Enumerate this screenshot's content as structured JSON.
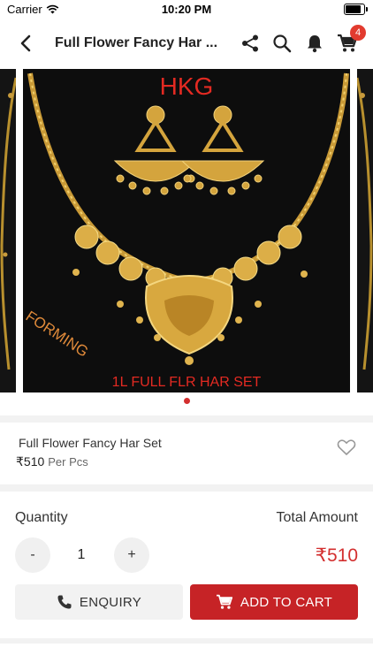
{
  "status": {
    "carrier": "Carrier",
    "time": "10:20 PM"
  },
  "nav": {
    "title": "Full Flower Fancy  Har ...",
    "cart_count": "4"
  },
  "gallery": {
    "brand_text": "HKG",
    "stamp_text": "FORMING",
    "caption": "1L FULL FLR HAR SET",
    "active_index": 0,
    "total_images": 1
  },
  "product": {
    "name": "Full Flower Fancy  Har Set",
    "price": "₹510",
    "unit": "Per Pcs"
  },
  "order": {
    "quantity_label": "Quantity",
    "total_label": "Total Amount",
    "minus": "-",
    "quantity": "1",
    "plus": "+",
    "total": "₹510"
  },
  "actions": {
    "enquiry": "ENQUIRY",
    "add_to_cart": "ADD TO CART"
  },
  "colors": {
    "accent": "#c62326",
    "price_red": "#d32f2f",
    "badge": "#e23b2f"
  }
}
